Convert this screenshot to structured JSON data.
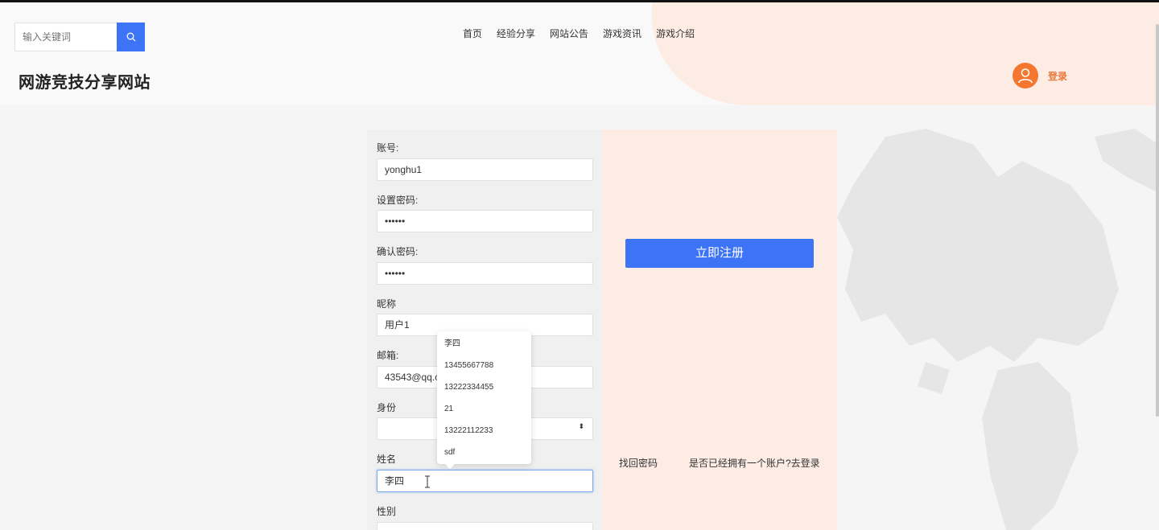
{
  "header": {
    "search_placeholder": "输入关键词",
    "nav": [
      "首页",
      "经验分享",
      "网站公告",
      "游戏资讯",
      "游戏介绍"
    ],
    "site_title": "网游竞技分享网站",
    "login_label": "登录"
  },
  "form": {
    "fields": [
      {
        "label": "账号:",
        "value": "yonghu1"
      },
      {
        "label": "设置密码:",
        "value": "••••••"
      },
      {
        "label": "确认密码:",
        "value": "••••••"
      },
      {
        "label": "昵称",
        "value": "用户1"
      },
      {
        "label": "邮箱:",
        "value": "43543@qq.c"
      },
      {
        "label": "身份",
        "value": ""
      },
      {
        "label": "姓名",
        "value": "李四"
      },
      {
        "label": "性别",
        "value": ""
      }
    ],
    "select_arrow": "⬍",
    "autocomplete": [
      "李四",
      "13455667788",
      "13222334455",
      "21",
      "13222112233",
      "sdf"
    ]
  },
  "actions": {
    "register_label": "立即注册",
    "forgot_password": "找回密码",
    "have_account": "是否已经拥有一个账户?去登录"
  },
  "colors": {
    "accent": "#3d74f6",
    "brand_orange": "#f5772f",
    "panel_peach": "#fdece4"
  }
}
